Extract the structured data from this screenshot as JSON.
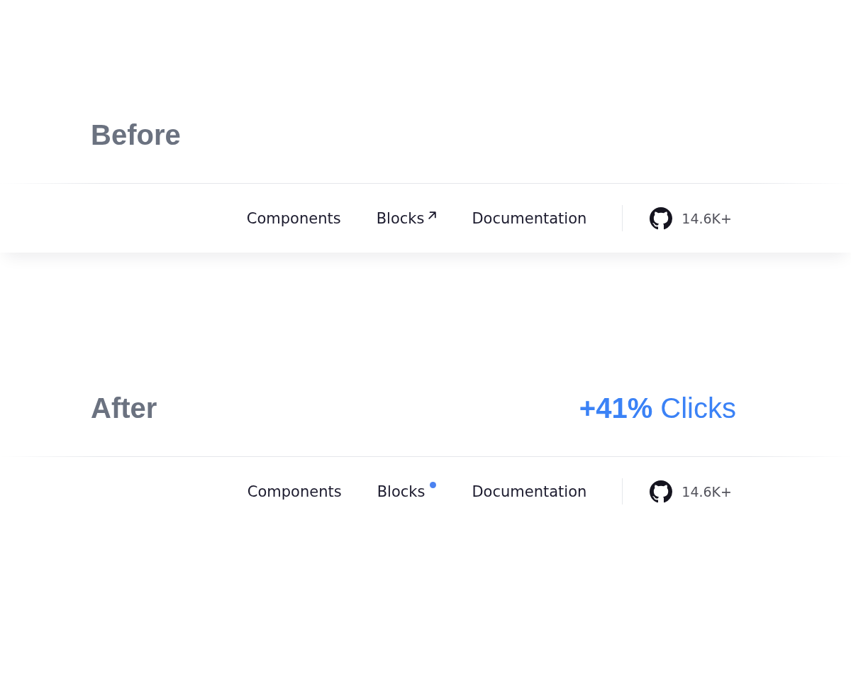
{
  "sections": [
    {
      "heading": "Before",
      "nav": {
        "links": [
          {
            "label": "Components",
            "kind": "plain"
          },
          {
            "label": "Blocks",
            "kind": "external"
          },
          {
            "label": "Documentation",
            "kind": "plain"
          }
        ],
        "github": {
          "count": "14.6K+"
        }
      }
    },
    {
      "heading": "After",
      "metric": "**+41%** Clicks",
      "nav": {
        "links": [
          {
            "label": "Components",
            "kind": "plain"
          },
          {
            "label": "Blocks",
            "kind": "dot"
          },
          {
            "label": "Documentation",
            "kind": "plain"
          }
        ],
        "github": {
          "count": "14.6K+"
        }
      }
    }
  ]
}
